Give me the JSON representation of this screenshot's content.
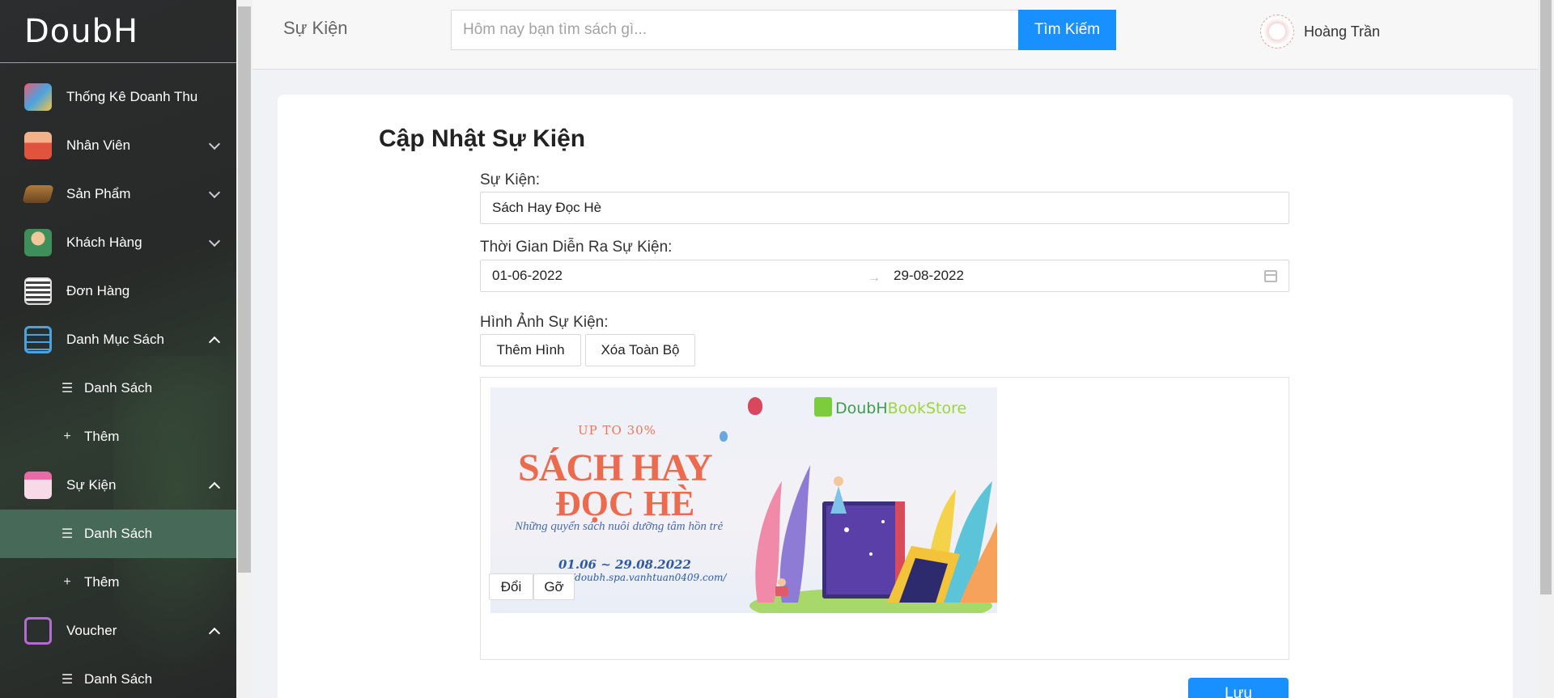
{
  "app": {
    "logo_text": "DoubH"
  },
  "sidebar": {
    "items": [
      {
        "label": "Thống Kê Doanh Thu",
        "icon": "chart-icon"
      },
      {
        "label": "Nhân Viên",
        "icon": "staff-icon"
      },
      {
        "label": "Sản Phẩm",
        "icon": "book-icon"
      },
      {
        "label": "Khách Hàng",
        "icon": "customer-icon"
      },
      {
        "label": "Đơn Hàng",
        "icon": "order-icon"
      },
      {
        "label": "Danh Mục Sách",
        "icon": "category-icon"
      },
      {
        "label": "Sự Kiện",
        "icon": "event-icon"
      },
      {
        "label": "Voucher",
        "icon": "voucher-icon"
      }
    ],
    "category_sub": {
      "list": "Danh Sách",
      "add": "Thêm"
    },
    "event_sub": {
      "list": "Danh Sách",
      "add": "Thêm"
    },
    "voucher_sub": {
      "list": "Danh Sách"
    },
    "active": "Sự Kiện / Danh Sách"
  },
  "header": {
    "title": "Sự Kiện",
    "search_placeholder": "Hôm nay bạn tìm sách gì...",
    "search_button": "Tìm Kiếm",
    "user_name": "Hoàng Trần"
  },
  "form": {
    "title": "Cập Nhật Sự Kiện",
    "event_label": "Sự Kiện:",
    "event_value": "Sách Hay Đọc Hè",
    "time_label": "Thời Gian Diễn Ra Sự Kiện:",
    "start_date": "01-06-2022",
    "end_date": "29-08-2022",
    "image_label": "Hình Ảnh Sự Kiện:",
    "add_image_button": "Thêm Hình",
    "clear_all_button": "Xóa Toàn Bộ",
    "change_button": "Đổi",
    "remove_button": "Gỡ",
    "save_button": "Lưu"
  },
  "banner": {
    "logo_main": "DoubH",
    "logo_accent": "BookStore",
    "promo": "UP TO 30%",
    "title_line1": "SÁCH HAY",
    "title_line2": "ĐỌC HÈ",
    "subtitle": "Những quyển sách nuôi dưỡng tâm hồn trẻ",
    "dates": "01.06 ~ 29.08.2022",
    "url": "Tại https://doubh.spa.vanhtuan0409.com/"
  },
  "colors": {
    "primary": "#1890ff",
    "sidebar_active": "#476a58",
    "banner_title": "#ec6a4e"
  }
}
